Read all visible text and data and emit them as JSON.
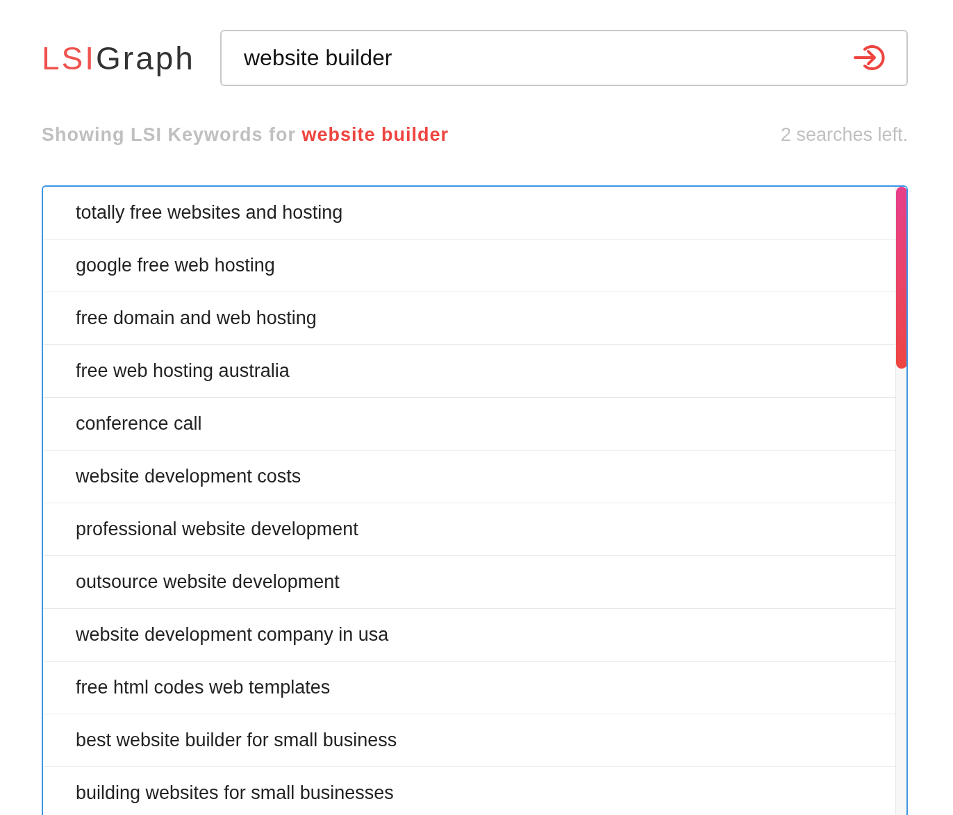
{
  "logo": {
    "accent": "LSI",
    "rest": "Graph"
  },
  "search": {
    "value": "website builder"
  },
  "heading": {
    "prefix": "Showing LSI Keywords for ",
    "query": "website builder"
  },
  "searches_left": "2 searches left.",
  "keywords": [
    "totally free websites and hosting",
    "google free web hosting",
    "free domain and web hosting",
    "free web hosting australia",
    "conference call",
    "website development costs",
    "professional website development",
    "outsource website development",
    "website development company in usa",
    "free html codes web templates",
    "best website builder for small business",
    "building websites for small businesses"
  ]
}
